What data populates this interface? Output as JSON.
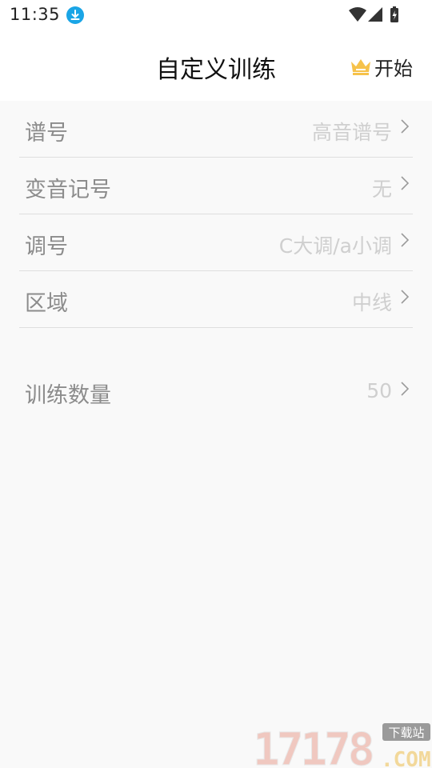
{
  "status_bar": {
    "time": "11:35",
    "icons": [
      "download-icon",
      "wifi-icon",
      "signal-icon",
      "battery-charging-icon"
    ]
  },
  "header": {
    "title": "自定义训练",
    "start_label": "开始",
    "start_icon": "crown-icon"
  },
  "settings": [
    {
      "label": "谱号",
      "value": "高音谱号"
    },
    {
      "label": "变音记号",
      "value": "无"
    },
    {
      "label": "调号",
      "value": "C大调/a小调"
    },
    {
      "label": "区域",
      "value": "中线"
    }
  ],
  "training_count": {
    "label": "训练数量",
    "value": "50"
  },
  "watermark": {
    "number": "17178",
    "domain": ".COM",
    "badge": "下载站"
  },
  "colors": {
    "accent_blue": "#1aa5e6",
    "crown_gold": "#f6c24a",
    "label_gray": "#8c8c8c",
    "value_gray": "#cfcfcf"
  }
}
